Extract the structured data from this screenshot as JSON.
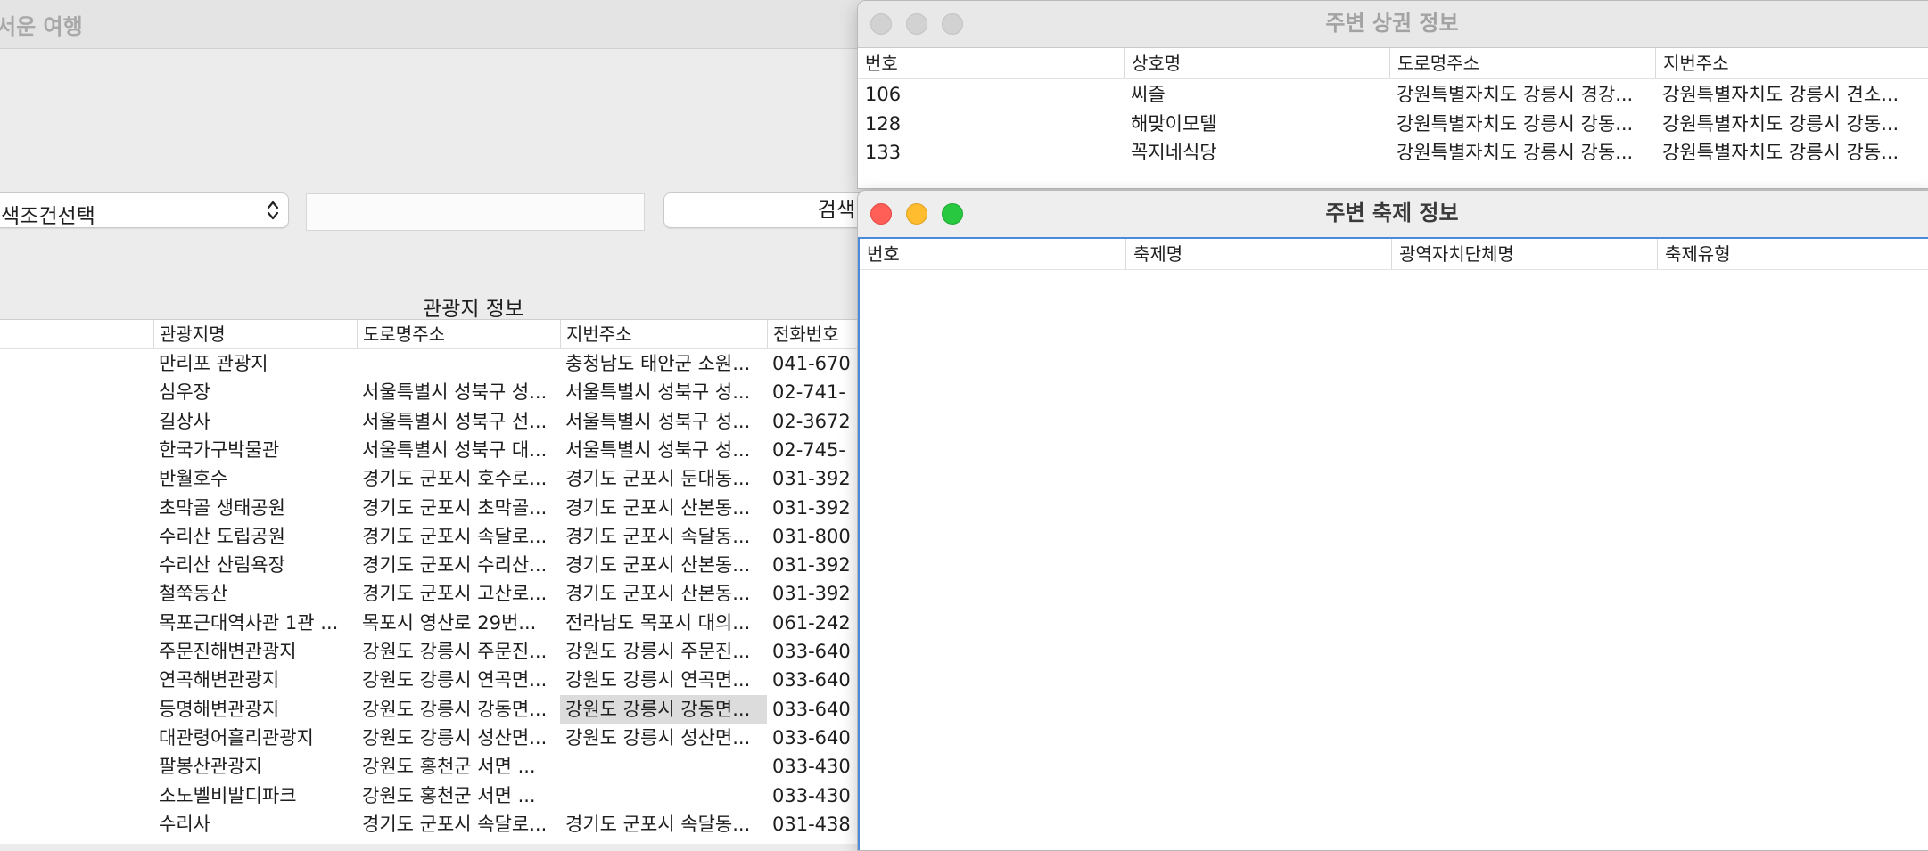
{
  "main_window": {
    "title": "서운 여행",
    "condition_select": {
      "label": "색조건선택"
    },
    "search_input": {
      "value": "",
      "placeholder": ""
    },
    "search_button": {
      "label": "검색"
    },
    "table_title": "관광지 정보",
    "columns": [
      "관광지명",
      "도로명주소",
      "지번주소",
      "전화번호"
    ],
    "rows": [
      {
        "name": "만리포 관광지",
        "road": "",
        "lot": "충청남도 태안군 소원...",
        "phone": "041-670"
      },
      {
        "name": "심우장",
        "road": "서울특별시 성북구 성...",
        "lot": "서울특별시 성북구 성...",
        "phone": "02-741-"
      },
      {
        "name": "길상사",
        "road": "서울특별시 성북구 선...",
        "lot": "서울특별시 성북구 성...",
        "phone": "02-3672"
      },
      {
        "name": "한국가구박물관",
        "road": "서울특별시 성북구 대...",
        "lot": "서울특별시 성북구 성...",
        "phone": "02-745-"
      },
      {
        "name": "반월호수",
        "road": "경기도 군포시 호수로...",
        "lot": "경기도 군포시 둔대동...",
        "phone": "031-392"
      },
      {
        "name": "초막골 생태공원",
        "road": "경기도 군포시 초막골...",
        "lot": "경기도 군포시 산본동...",
        "phone": "031-392"
      },
      {
        "name": "수리산 도립공원",
        "road": "경기도 군포시 속달로...",
        "lot": "경기도 군포시 속달동...",
        "phone": "031-800"
      },
      {
        "name": "수리산 산림욕장",
        "road": "경기도 군포시 수리산...",
        "lot": "경기도 군포시 산본동...",
        "phone": "031-392"
      },
      {
        "name": "철쭉동산",
        "road": "경기도 군포시 고산로...",
        "lot": "경기도 군포시 산본동...",
        "phone": "031-392"
      },
      {
        "name": "목포근대역사관 1관 ...",
        "road": "목포시 영산로 29번...",
        "lot": "전라남도 목포시 대의...",
        "phone": "061-242"
      },
      {
        "name": "주문진해변관광지",
        "road": "강원도 강릉시 주문진...",
        "lot": "강원도 강릉시 주문진...",
        "phone": "033-640"
      },
      {
        "name": "연곡해변관광지",
        "road": "강원도 강릉시 연곡면...",
        "lot": "강원도 강릉시 연곡면...",
        "phone": "033-640"
      },
      {
        "name": "등명해변관광지",
        "road": "강원도 강릉시 강동면...",
        "lot": "강원도 강릉시 강동면...",
        "phone": "033-640",
        "selected": true
      },
      {
        "name": "대관령어흘리관광지",
        "road": "강원도 강릉시 성산면...",
        "lot": "강원도 강릉시 성산면...",
        "phone": "033-640"
      },
      {
        "name": "팔봉산관광지",
        "road": "강원도 홍천군 서면 ...",
        "lot": "",
        "phone": "033-430"
      },
      {
        "name": "소노벨비발디파크",
        "road": "강원도 홍천군 서면 ...",
        "lot": "",
        "phone": "033-430"
      },
      {
        "name": "수리사",
        "road": "경기도 군포시 속달로...",
        "lot": "경기도 군포시 속달동...",
        "phone": "031-438"
      }
    ]
  },
  "shop_window": {
    "title": "주변 상권 정보",
    "columns": [
      "번호",
      "상호명",
      "도로명주소",
      "지번주소"
    ],
    "rows": [
      {
        "no": "106",
        "name": "씨즐",
        "road": "강원특별자치도 강릉시 경강...",
        "lot": "강원특별자치도 강릉시 견소..."
      },
      {
        "no": "128",
        "name": "해맞이모텔",
        "road": "강원특별자치도 강릉시 강동...",
        "lot": "강원특별자치도 강릉시 강동..."
      },
      {
        "no": "133",
        "name": "꼭지네식당",
        "road": "강원특별자치도 강릉시 강동...",
        "lot": "강원특별자치도 강릉시 강동..."
      }
    ]
  },
  "festival_window": {
    "title": "주변 축제 정보",
    "columns": [
      "번호",
      "축제명",
      "광역자치단체명",
      "축제유형"
    ],
    "rows": []
  },
  "icons": {
    "select_arrows": "chevron-up-down-icon",
    "window_close": "close-icon",
    "window_minimize": "minimize-icon",
    "window_zoom": "zoom-icon"
  },
  "colors": {
    "selection": "#dcdcdc",
    "focus_ring": "#4a8ad8",
    "traffic_red": "#ff5f57",
    "traffic_yellow": "#febc2e",
    "traffic_green": "#28c840"
  }
}
